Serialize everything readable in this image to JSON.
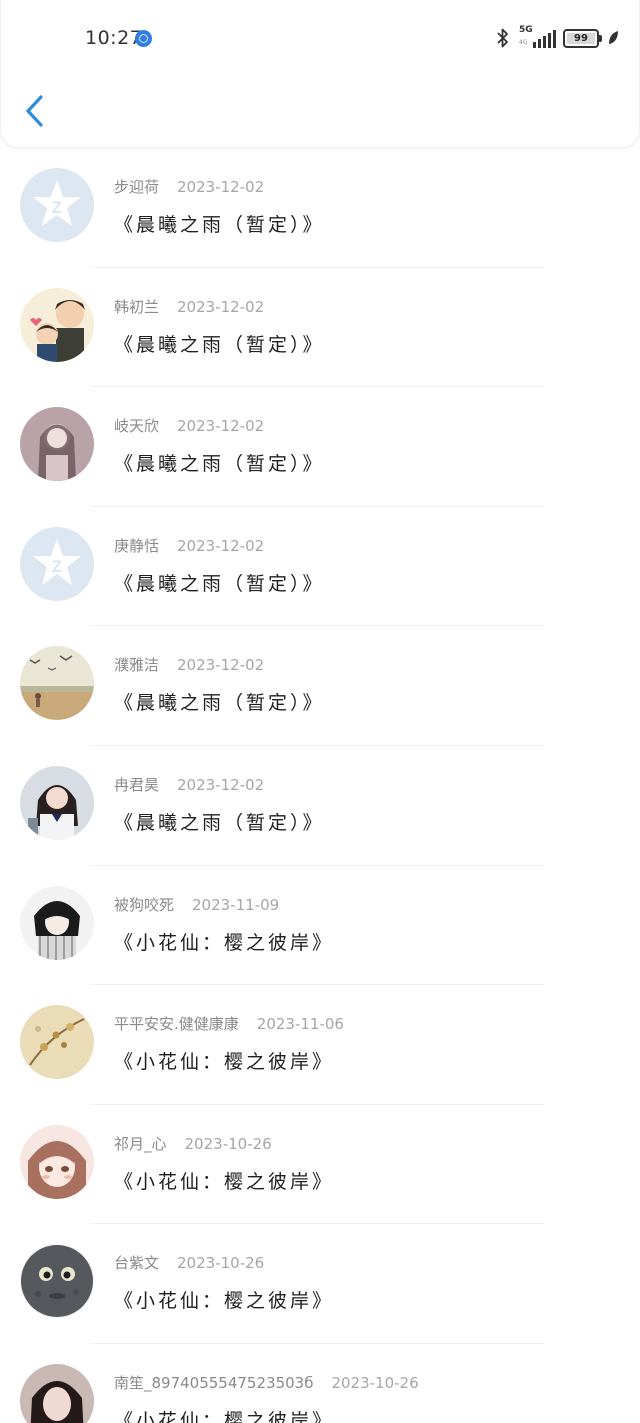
{
  "status_bar": {
    "time": "10:27",
    "network": "5G",
    "network_sub": "4G",
    "battery": "99",
    "accent": "#2f7fe0"
  },
  "header": {
    "back_icon": "chevron-left-icon",
    "back_color": "#2a8cdb"
  },
  "items": [
    {
      "name": "步迎荷",
      "date": "2023-12-02",
      "title": "《晨曦之雨（暂定）》",
      "avatar": "qq-default"
    },
    {
      "name": "韩初兰",
      "date": "2023-12-02",
      "title": "《晨曦之雨（暂定）》",
      "avatar": "cartoon-couple"
    },
    {
      "name": "岐天欣",
      "date": "2023-12-02",
      "title": "《晨曦之雨（暂定）》",
      "avatar": "girl-photo"
    },
    {
      "name": "庚静恬",
      "date": "2023-12-02",
      "title": "《晨曦之雨（暂定）》",
      "avatar": "qq-default"
    },
    {
      "name": "濮雅洁",
      "date": "2023-12-02",
      "title": "《晨曦之雨（暂定）》",
      "avatar": "beach-birds"
    },
    {
      "name": "冉君昊",
      "date": "2023-12-02",
      "title": "《晨曦之雨（暂定）》",
      "avatar": "uniform-girl"
    },
    {
      "name": "被狗咬死",
      "date": "2023-11-09",
      "title": "《小花仙：樱之彼岸》",
      "avatar": "anime-boy"
    },
    {
      "name": "平平安安.健健康康",
      "date": "2023-11-06",
      "title": "《小花仙：樱之彼岸》",
      "avatar": "flower-painting"
    },
    {
      "name": "祁月_心",
      "date": "2023-10-26",
      "title": "《小花仙：樱之彼岸》",
      "avatar": "anime-girl"
    },
    {
      "name": "台紫文",
      "date": "2023-10-26",
      "title": "《小花仙：樱之彼岸》",
      "avatar": "moon-face"
    },
    {
      "name": "南笙_8974055547523503б",
      "date": "2023-10-26",
      "title": "《小花仙：樱之彼岸》",
      "avatar": "dark-hair-girl"
    }
  ]
}
